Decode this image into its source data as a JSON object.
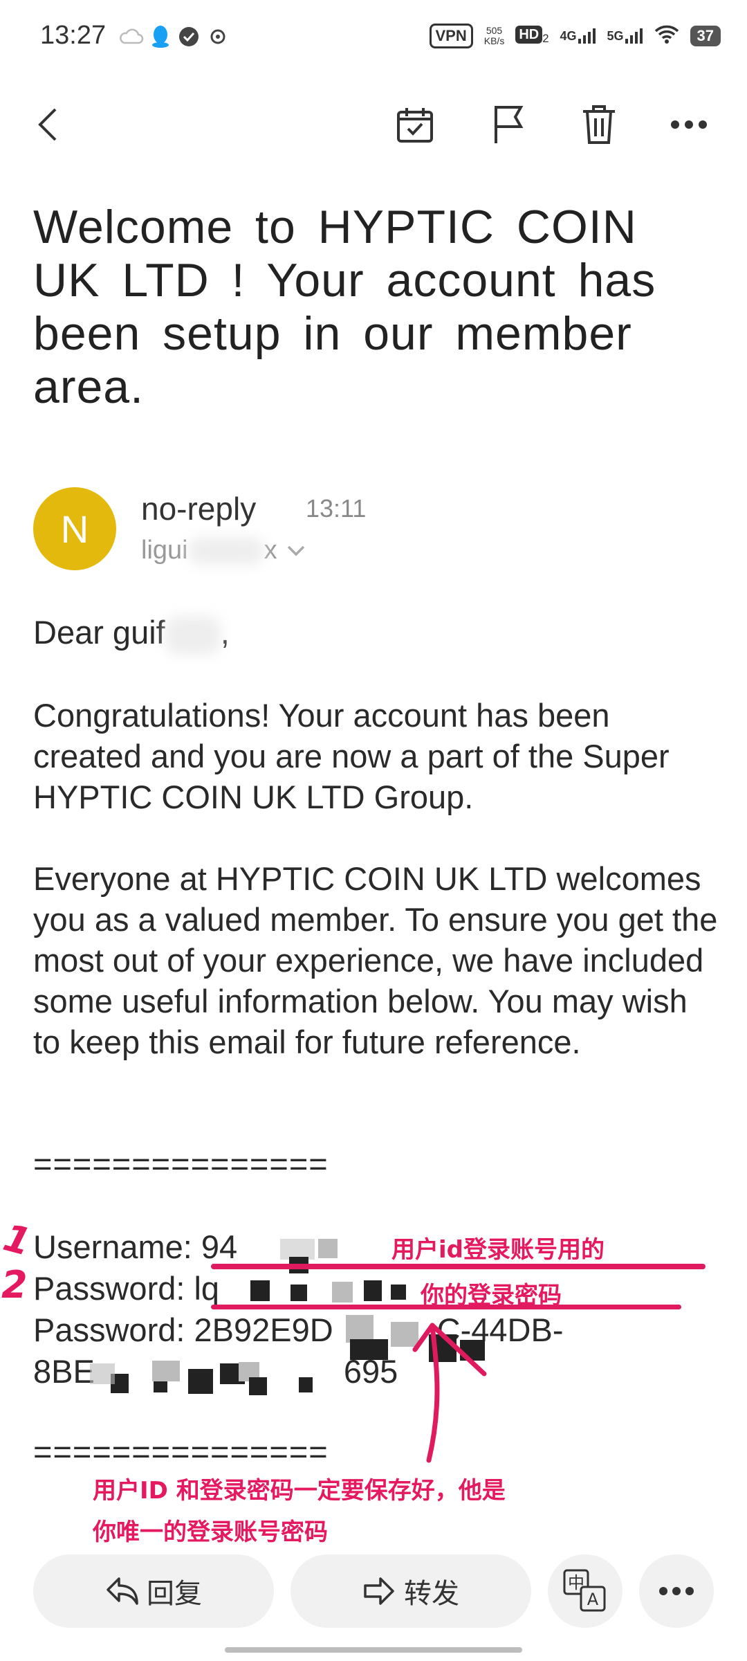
{
  "status_bar": {
    "time": "13:27",
    "vpn": "VPN",
    "speed_value": "505",
    "speed_unit": "KB/s",
    "hd": "HD",
    "hd_sub": "2",
    "net1": "4G",
    "net2": "5G",
    "battery": "37"
  },
  "email": {
    "subject": "Welcome to HYPTIC COIN UK LTD ! Your account has been setup in our member area.",
    "sender": {
      "initial": "N",
      "name": "no-reply",
      "time": "13:11",
      "email_visible": "ligui",
      "email_end": "x"
    },
    "greeting": "Dear guif",
    "greeting_end": ",",
    "paragraph1": "Congratulations! Your account has been created and you are now a part of the Super HYPTIC COIN UK LTD Group.",
    "paragraph2": "Everyone at HYPTIC COIN UK LTD welcomes you as a valued member. To ensure you get the most out of your experience, we have included some useful information below. You may wish to keep this email for future reference.",
    "separator": "===============",
    "username_label": "Username: 94",
    "password_label": "Password: lq",
    "password2_line1": "Password: 2B92E9D",
    "password2_line1_end": "C-44DB-",
    "password2_line2_start": "8BE",
    "password2_line2_end": "695"
  },
  "annotations": {
    "mark1": "1",
    "mark2": "2",
    "note_username": "用户id登录账号用的",
    "note_password": "你的登录密码",
    "note_bottom_line1": "用户ID 和登录密码一定要保存好，他是",
    "note_bottom_line2": "你唯一的登录账号密码"
  },
  "bottom_bar": {
    "reply": "回复",
    "forward": "转发",
    "translate_icon": "translate-icon",
    "more_icon": "more-icon"
  },
  "colors": {
    "avatar": "#e4b90d",
    "annotation": "#e5195f"
  }
}
